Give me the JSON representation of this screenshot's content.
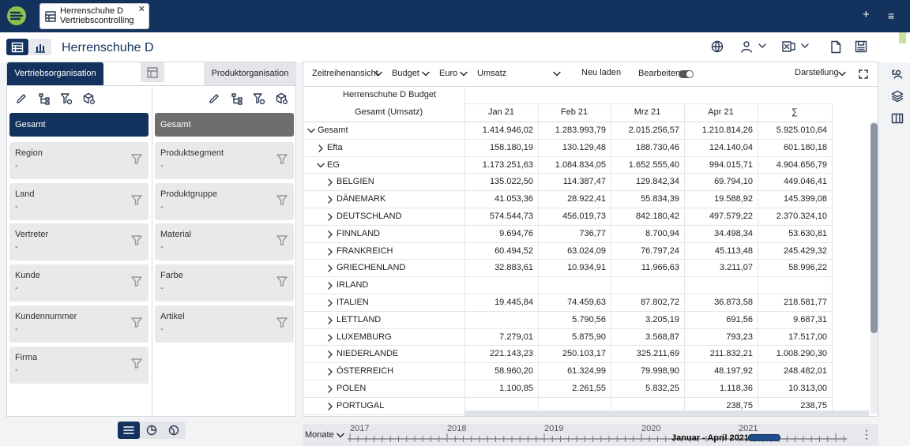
{
  "topbar": {
    "tab_line1": "Herrenschuhe D",
    "tab_line2": "Vertriebscontrolling",
    "close": "✕",
    "plus": "+",
    "menu": "≡"
  },
  "header": {
    "title": "Herrenschuhe D"
  },
  "left": {
    "tab_left": "Vertriebsorganisation",
    "tab_right": "Produktorganisation",
    "col1_root": "Gesamt",
    "col2_root": "Gesamt",
    "col1_filters": [
      {
        "label": "Region",
        "value": "-"
      },
      {
        "label": "Land",
        "value": "-"
      },
      {
        "label": "Vertreter",
        "value": "-"
      },
      {
        "label": "Kunde",
        "value": "-"
      },
      {
        "label": "Kundennummer",
        "value": "-"
      },
      {
        "label": "Firma",
        "value": "-"
      }
    ],
    "col2_filters": [
      {
        "label": "Produktsegment",
        "value": "-"
      },
      {
        "label": "Produktgruppe",
        "value": "-"
      },
      {
        "label": "Material",
        "value": "-"
      },
      {
        "label": "Farbe",
        "value": "-"
      },
      {
        "label": "Artikel",
        "value": "-"
      }
    ]
  },
  "data_toolbar": {
    "view": "Zeitreihenansicht",
    "version": "Budget",
    "currency": "Euro",
    "measure": "Umsatz",
    "reload": "Neu laden",
    "edit": "Bearbeiten",
    "display": "Darstellung"
  },
  "table": {
    "header_budget": "Herrenschuhe D Budget",
    "header_measure": "Gesamt (Umsatz)",
    "columns": [
      "Jan 21",
      "Feb 21",
      "Mrz 21",
      "Apr 21",
      "∑"
    ],
    "rows": [
      {
        "label": "Gesamt",
        "level": 0,
        "toggle": "down",
        "values": [
          "1.414.946,02",
          "1.283.993,79",
          "2.015.256,57",
          "1.210.814,26",
          "5.925.010,64"
        ]
      },
      {
        "label": "Efta",
        "level": 1,
        "toggle": "right",
        "values": [
          "158.180,19",
          "130.129,48",
          "188.730,46",
          "124.140,04",
          "601.180,18"
        ]
      },
      {
        "label": "EG",
        "level": 1,
        "toggle": "down",
        "values": [
          "1.173.251,63",
          "1.084.834,05",
          "1.652.555,40",
          "994.015,71",
          "4.904.656,79"
        ]
      },
      {
        "label": "BELGIEN",
        "level": 2,
        "toggle": "right",
        "values": [
          "135.022,50",
          "114.387,47",
          "129.842,34",
          "69.794,10",
          "449.046,41"
        ]
      },
      {
        "label": "DÄNEMARK",
        "level": 2,
        "toggle": "right",
        "values": [
          "41.053,36",
          "28.922,41",
          "55.834,39",
          "19.588,92",
          "145.399,08"
        ]
      },
      {
        "label": "DEUTSCHLAND",
        "level": 2,
        "toggle": "right",
        "values": [
          "574.544,73",
          "456.019,73",
          "842.180,42",
          "497.579,22",
          "2.370.324,10"
        ]
      },
      {
        "label": "FINNLAND",
        "level": 2,
        "toggle": "right",
        "values": [
          "9.694,76",
          "736,77",
          "8.700,94",
          "34.498,34",
          "53.630,81"
        ]
      },
      {
        "label": "FRANKREICH",
        "level": 2,
        "toggle": "right",
        "values": [
          "60.494,52",
          "63.024,09",
          "76.797,24",
          "45.113,48",
          "245.429,32"
        ]
      },
      {
        "label": "GRIECHENLAND",
        "level": 2,
        "toggle": "right",
        "values": [
          "32.883,61",
          "10.934,91",
          "11.966,63",
          "3.211,07",
          "58.996,22"
        ]
      },
      {
        "label": "IRLAND",
        "level": 2,
        "toggle": "right",
        "values": [
          "",
          "",
          "",
          "",
          ""
        ]
      },
      {
        "label": "ITALIEN",
        "level": 2,
        "toggle": "right",
        "values": [
          "19.445,84",
          "74.459,63",
          "87.802,72",
          "36.873,58",
          "218.581,77"
        ]
      },
      {
        "label": "LETTLAND",
        "level": 2,
        "toggle": "right",
        "values": [
          "",
          "5.790,56",
          "3.205,19",
          "691,56",
          "9.687,31"
        ]
      },
      {
        "label": "LUXEMBURG",
        "level": 2,
        "toggle": "right",
        "values": [
          "7.279,01",
          "5.875,90",
          "3.568,87",
          "793,23",
          "17.517,00"
        ]
      },
      {
        "label": "NIEDERLANDE",
        "level": 2,
        "toggle": "right",
        "values": [
          "221.143,23",
          "250.103,17",
          "325.211,69",
          "211.832,21",
          "1.008.290,30"
        ]
      },
      {
        "label": "ÖSTERREICH",
        "level": 2,
        "toggle": "right",
        "values": [
          "58.960,20",
          "61.324,99",
          "79.998,90",
          "48.197,92",
          "248.482,01"
        ]
      },
      {
        "label": "POLEN",
        "level": 2,
        "toggle": "right",
        "values": [
          "1.100,85",
          "2.261,55",
          "5.832,25",
          "1.118,36",
          "10.313,00"
        ]
      },
      {
        "label": "PORTUGAL",
        "level": 2,
        "toggle": "right",
        "values": [
          "",
          "",
          "",
          "238,75",
          "238,75"
        ]
      }
    ]
  },
  "timeline": {
    "unit": "Monate",
    "years": [
      "2017",
      "2018",
      "2019",
      "2020",
      "2021"
    ],
    "range": "Januar - April 2021"
  },
  "colors": {
    "navy": "#14325e",
    "logo_green": "#8bc34a",
    "accent_green": "#c7e29a"
  }
}
